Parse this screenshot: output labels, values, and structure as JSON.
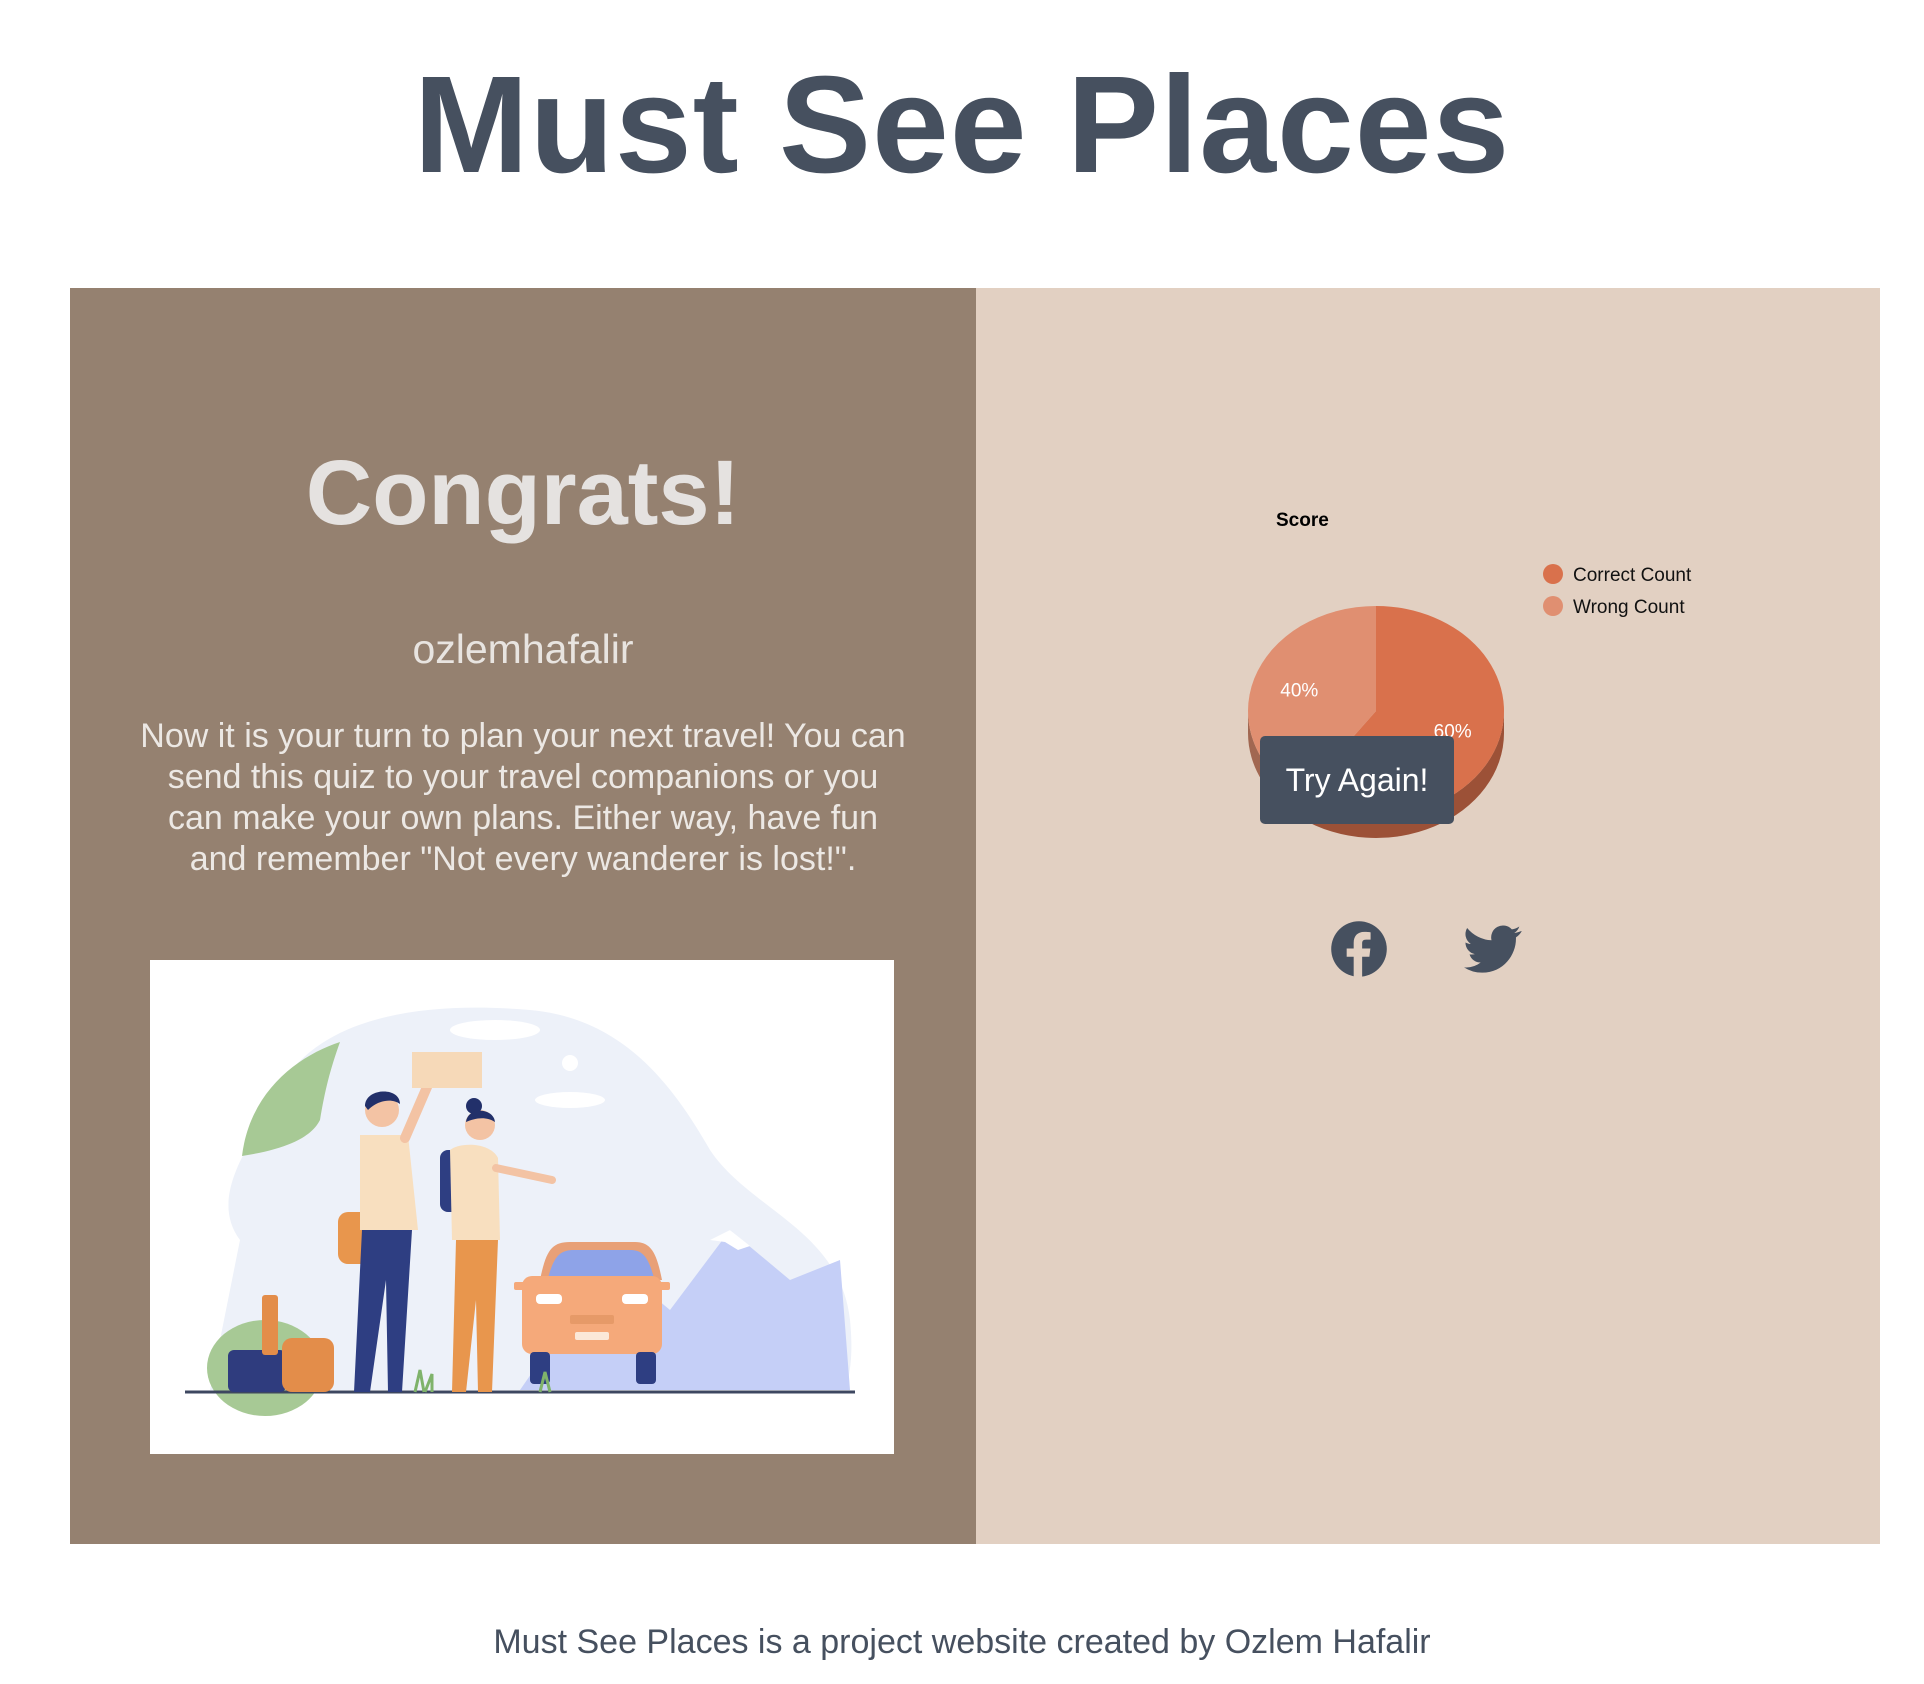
{
  "header": {
    "title": "Must See Places"
  },
  "result": {
    "heading": "Congrats!",
    "username": "ozlemhafalir",
    "message": "Now it is your turn to plan your next travel! You can send this quiz to your travel companions or you can make your own plans. Either way, have fun and remember \"Not every wanderer is lost!\"."
  },
  "chart_data": {
    "type": "pie",
    "title": "Score",
    "categories": [
      "Correct Count",
      "Wrong Count"
    ],
    "values": [
      60,
      40
    ],
    "labels": [
      "60%",
      "40%"
    ],
    "colors": [
      "#d9714c",
      "#e08f71"
    ],
    "legend_position": "right"
  },
  "actions": {
    "try_again_label": "Try Again!"
  },
  "social": {
    "facebook_icon": "facebook-icon",
    "twitter_icon": "twitter-icon"
  },
  "footer": {
    "text": "Must See Places is a project website created by Ozlem Hafalir"
  }
}
